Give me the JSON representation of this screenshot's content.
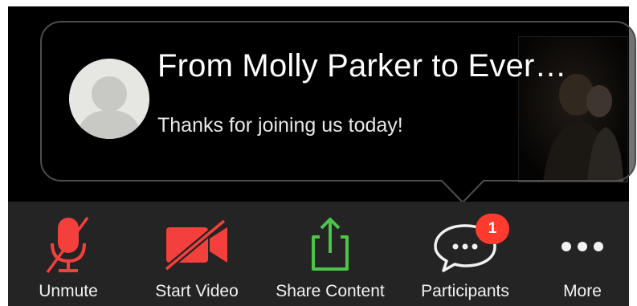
{
  "colors": {
    "toolbar_bg": "#242424",
    "muted_red": "#f4403d",
    "share_green": "#4ec34a",
    "badge_red": "#ff3b30"
  },
  "chat_message": {
    "title": "From Molly Parker to Ever…",
    "body": "Thanks for joining us today!",
    "avatar_icon": "default-user-avatar-icon"
  },
  "toolbar": {
    "unmute": {
      "label": "Unmute",
      "icon": "microphone-muted-icon"
    },
    "start_video": {
      "label": "Start Video",
      "icon": "video-camera-off-icon"
    },
    "share_content": {
      "label": "Share Content",
      "icon": "share-upload-icon"
    },
    "participants": {
      "label": "Participants",
      "icon": "chat-bubble-icon",
      "badge": "1"
    },
    "more": {
      "label": "More",
      "icon": "more-dots-icon"
    }
  }
}
